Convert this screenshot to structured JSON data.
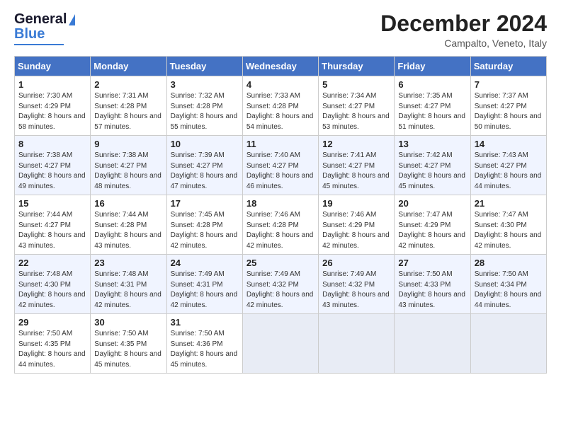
{
  "logo": {
    "line1": "General",
    "line2": "Blue"
  },
  "title": "December 2024",
  "subtitle": "Campalto, Veneto, Italy",
  "headers": [
    "Sunday",
    "Monday",
    "Tuesday",
    "Wednesday",
    "Thursday",
    "Friday",
    "Saturday"
  ],
  "weeks": [
    [
      {
        "day": "1",
        "sunrise": "7:30 AM",
        "sunset": "4:29 PM",
        "daylight": "8 hours and 58 minutes."
      },
      {
        "day": "2",
        "sunrise": "7:31 AM",
        "sunset": "4:28 PM",
        "daylight": "8 hours and 57 minutes."
      },
      {
        "day": "3",
        "sunrise": "7:32 AM",
        "sunset": "4:28 PM",
        "daylight": "8 hours and 55 minutes."
      },
      {
        "day": "4",
        "sunrise": "7:33 AM",
        "sunset": "4:28 PM",
        "daylight": "8 hours and 54 minutes."
      },
      {
        "day": "5",
        "sunrise": "7:34 AM",
        "sunset": "4:27 PM",
        "daylight": "8 hours and 53 minutes."
      },
      {
        "day": "6",
        "sunrise": "7:35 AM",
        "sunset": "4:27 PM",
        "daylight": "8 hours and 51 minutes."
      },
      {
        "day": "7",
        "sunrise": "7:37 AM",
        "sunset": "4:27 PM",
        "daylight": "8 hours and 50 minutes."
      }
    ],
    [
      {
        "day": "8",
        "sunrise": "7:38 AM",
        "sunset": "4:27 PM",
        "daylight": "8 hours and 49 minutes."
      },
      {
        "day": "9",
        "sunrise": "7:38 AM",
        "sunset": "4:27 PM",
        "daylight": "8 hours and 48 minutes."
      },
      {
        "day": "10",
        "sunrise": "7:39 AM",
        "sunset": "4:27 PM",
        "daylight": "8 hours and 47 minutes."
      },
      {
        "day": "11",
        "sunrise": "7:40 AM",
        "sunset": "4:27 PM",
        "daylight": "8 hours and 46 minutes."
      },
      {
        "day": "12",
        "sunrise": "7:41 AM",
        "sunset": "4:27 PM",
        "daylight": "8 hours and 45 minutes."
      },
      {
        "day": "13",
        "sunrise": "7:42 AM",
        "sunset": "4:27 PM",
        "daylight": "8 hours and 45 minutes."
      },
      {
        "day": "14",
        "sunrise": "7:43 AM",
        "sunset": "4:27 PM",
        "daylight": "8 hours and 44 minutes."
      }
    ],
    [
      {
        "day": "15",
        "sunrise": "7:44 AM",
        "sunset": "4:27 PM",
        "daylight": "8 hours and 43 minutes."
      },
      {
        "day": "16",
        "sunrise": "7:44 AM",
        "sunset": "4:28 PM",
        "daylight": "8 hours and 43 minutes."
      },
      {
        "day": "17",
        "sunrise": "7:45 AM",
        "sunset": "4:28 PM",
        "daylight": "8 hours and 42 minutes."
      },
      {
        "day": "18",
        "sunrise": "7:46 AM",
        "sunset": "4:28 PM",
        "daylight": "8 hours and 42 minutes."
      },
      {
        "day": "19",
        "sunrise": "7:46 AM",
        "sunset": "4:29 PM",
        "daylight": "8 hours and 42 minutes."
      },
      {
        "day": "20",
        "sunrise": "7:47 AM",
        "sunset": "4:29 PM",
        "daylight": "8 hours and 42 minutes."
      },
      {
        "day": "21",
        "sunrise": "7:47 AM",
        "sunset": "4:30 PM",
        "daylight": "8 hours and 42 minutes."
      }
    ],
    [
      {
        "day": "22",
        "sunrise": "7:48 AM",
        "sunset": "4:30 PM",
        "daylight": "8 hours and 42 minutes."
      },
      {
        "day": "23",
        "sunrise": "7:48 AM",
        "sunset": "4:31 PM",
        "daylight": "8 hours and 42 minutes."
      },
      {
        "day": "24",
        "sunrise": "7:49 AM",
        "sunset": "4:31 PM",
        "daylight": "8 hours and 42 minutes."
      },
      {
        "day": "25",
        "sunrise": "7:49 AM",
        "sunset": "4:32 PM",
        "daylight": "8 hours and 42 minutes."
      },
      {
        "day": "26",
        "sunrise": "7:49 AM",
        "sunset": "4:32 PM",
        "daylight": "8 hours and 43 minutes."
      },
      {
        "day": "27",
        "sunrise": "7:50 AM",
        "sunset": "4:33 PM",
        "daylight": "8 hours and 43 minutes."
      },
      {
        "day": "28",
        "sunrise": "7:50 AM",
        "sunset": "4:34 PM",
        "daylight": "8 hours and 44 minutes."
      }
    ],
    [
      {
        "day": "29",
        "sunrise": "7:50 AM",
        "sunset": "4:35 PM",
        "daylight": "8 hours and 44 minutes."
      },
      {
        "day": "30",
        "sunrise": "7:50 AM",
        "sunset": "4:35 PM",
        "daylight": "8 hours and 45 minutes."
      },
      {
        "day": "31",
        "sunrise": "7:50 AM",
        "sunset": "4:36 PM",
        "daylight": "8 hours and 45 minutes."
      },
      null,
      null,
      null,
      null
    ]
  ]
}
